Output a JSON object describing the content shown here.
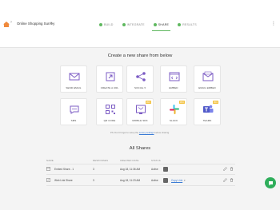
{
  "header": {
    "survey_name": "Online Shopping Survey",
    "steps": [
      {
        "label": "BUILD",
        "completed": true,
        "active": false
      },
      {
        "label": "INTEGRATE",
        "completed": true,
        "active": false
      },
      {
        "label": "SHARE",
        "completed": true,
        "active": true
      },
      {
        "label": "RESULTS",
        "completed": true,
        "active": false
      }
    ]
  },
  "create_section": {
    "title": "Create a new share from below",
    "tiles": [
      {
        "label": "SEND EMAIL",
        "icon": "envelope-icon"
      },
      {
        "label": "CREATE A URL",
        "icon": "link-icon"
      },
      {
        "label": "SOCIAL",
        "icon": "share-icon",
        "caret": true
      },
      {
        "label": "EMBED",
        "icon": "code-icon"
      },
      {
        "label": "EMAIL EMBED",
        "icon": "email-embed-icon"
      },
      {
        "label": "SMS",
        "icon": "sms-icon"
      },
      {
        "label": "QR CODE",
        "icon": "qr-code-icon"
      },
      {
        "label": "MOBILE SDK",
        "icon": "mobile-sdk-icon",
        "badge": "PRO"
      },
      {
        "label": "SLACK",
        "icon": "slack-icon",
        "badge": "PRO"
      },
      {
        "label": "TEAMS",
        "icon": "teams-icon",
        "badge": "PRO"
      }
    ],
    "note_prefix": "PS: Don't forget to setup the",
    "note_link": "survey settings",
    "note_suffix": "before sharing."
  },
  "shares": {
    "title": "All Shares",
    "headers": [
      "NAME",
      "RESPONSES",
      "CREATED DATE",
      "STATUS"
    ],
    "rows": [
      {
        "name": "Embed Share - 1",
        "responses": "3",
        "created": "Aug 18, 11:36 AM",
        "status": "Active",
        "link": ""
      },
      {
        "name": "Web Link Share",
        "responses": "3",
        "created": "Aug 18, 11:23 AM",
        "status": "Active",
        "link": "Copy Link"
      }
    ]
  },
  "colors": {
    "accent_purple": "#7c5cc4",
    "check_green": "#5fb85f",
    "pro_badge": "#f3c344",
    "link_blue": "#3a7bd5",
    "chat_green": "#2fae5b"
  }
}
